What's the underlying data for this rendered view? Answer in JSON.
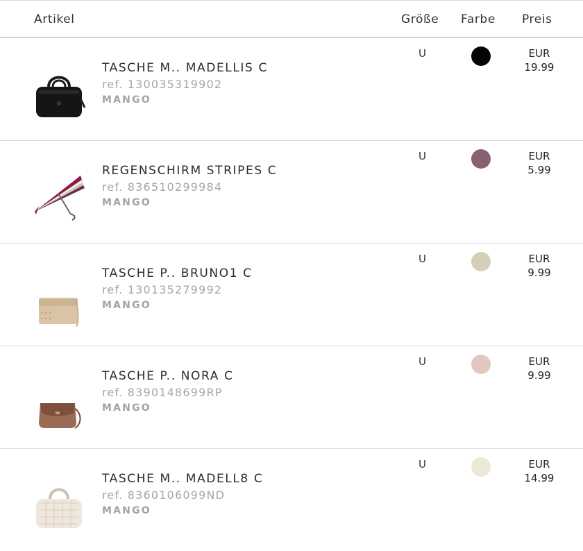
{
  "header": {
    "artikel": "Artikel",
    "groesse": "Größe",
    "farbe": "Farbe",
    "preis": "Preis"
  },
  "items": [
    {
      "name": "TASCHE M.. MADELLIS C",
      "ref": "ref. 130035319902",
      "brand": "MANGO",
      "size": "U",
      "color": "#050505",
      "currency": "EUR",
      "price": "19.99",
      "image": "black-handbag-icon"
    },
    {
      "name": "REGENSCHIRM STRIPES C",
      "ref": "ref. 836510299984",
      "brand": "MANGO",
      "size": "U",
      "color": "#8a5f73",
      "currency": "EUR",
      "price": "5.99",
      "image": "striped-umbrella-icon"
    },
    {
      "name": "TASCHE P.. BRUNO1 C",
      "ref": "ref. 130135279992",
      "brand": "MANGO",
      "size": "U",
      "color": "#d6cfb8",
      "currency": "EUR",
      "price": "9.99",
      "image": "beige-clutch-icon"
    },
    {
      "name": "TASCHE P.. NORA C",
      "ref": "ref. 8390148699RP",
      "brand": "MANGO",
      "size": "U",
      "color": "#e3c6c0",
      "currency": "EUR",
      "price": "9.99",
      "image": "brown-saddle-bag-icon"
    },
    {
      "name": "TASCHE M.. MADELL8 C",
      "ref": "ref. 8360106099ND",
      "brand": "MANGO",
      "size": "U",
      "color": "#ece8d6",
      "currency": "EUR",
      "price": "14.99",
      "image": "cream-quilted-bag-icon"
    }
  ]
}
